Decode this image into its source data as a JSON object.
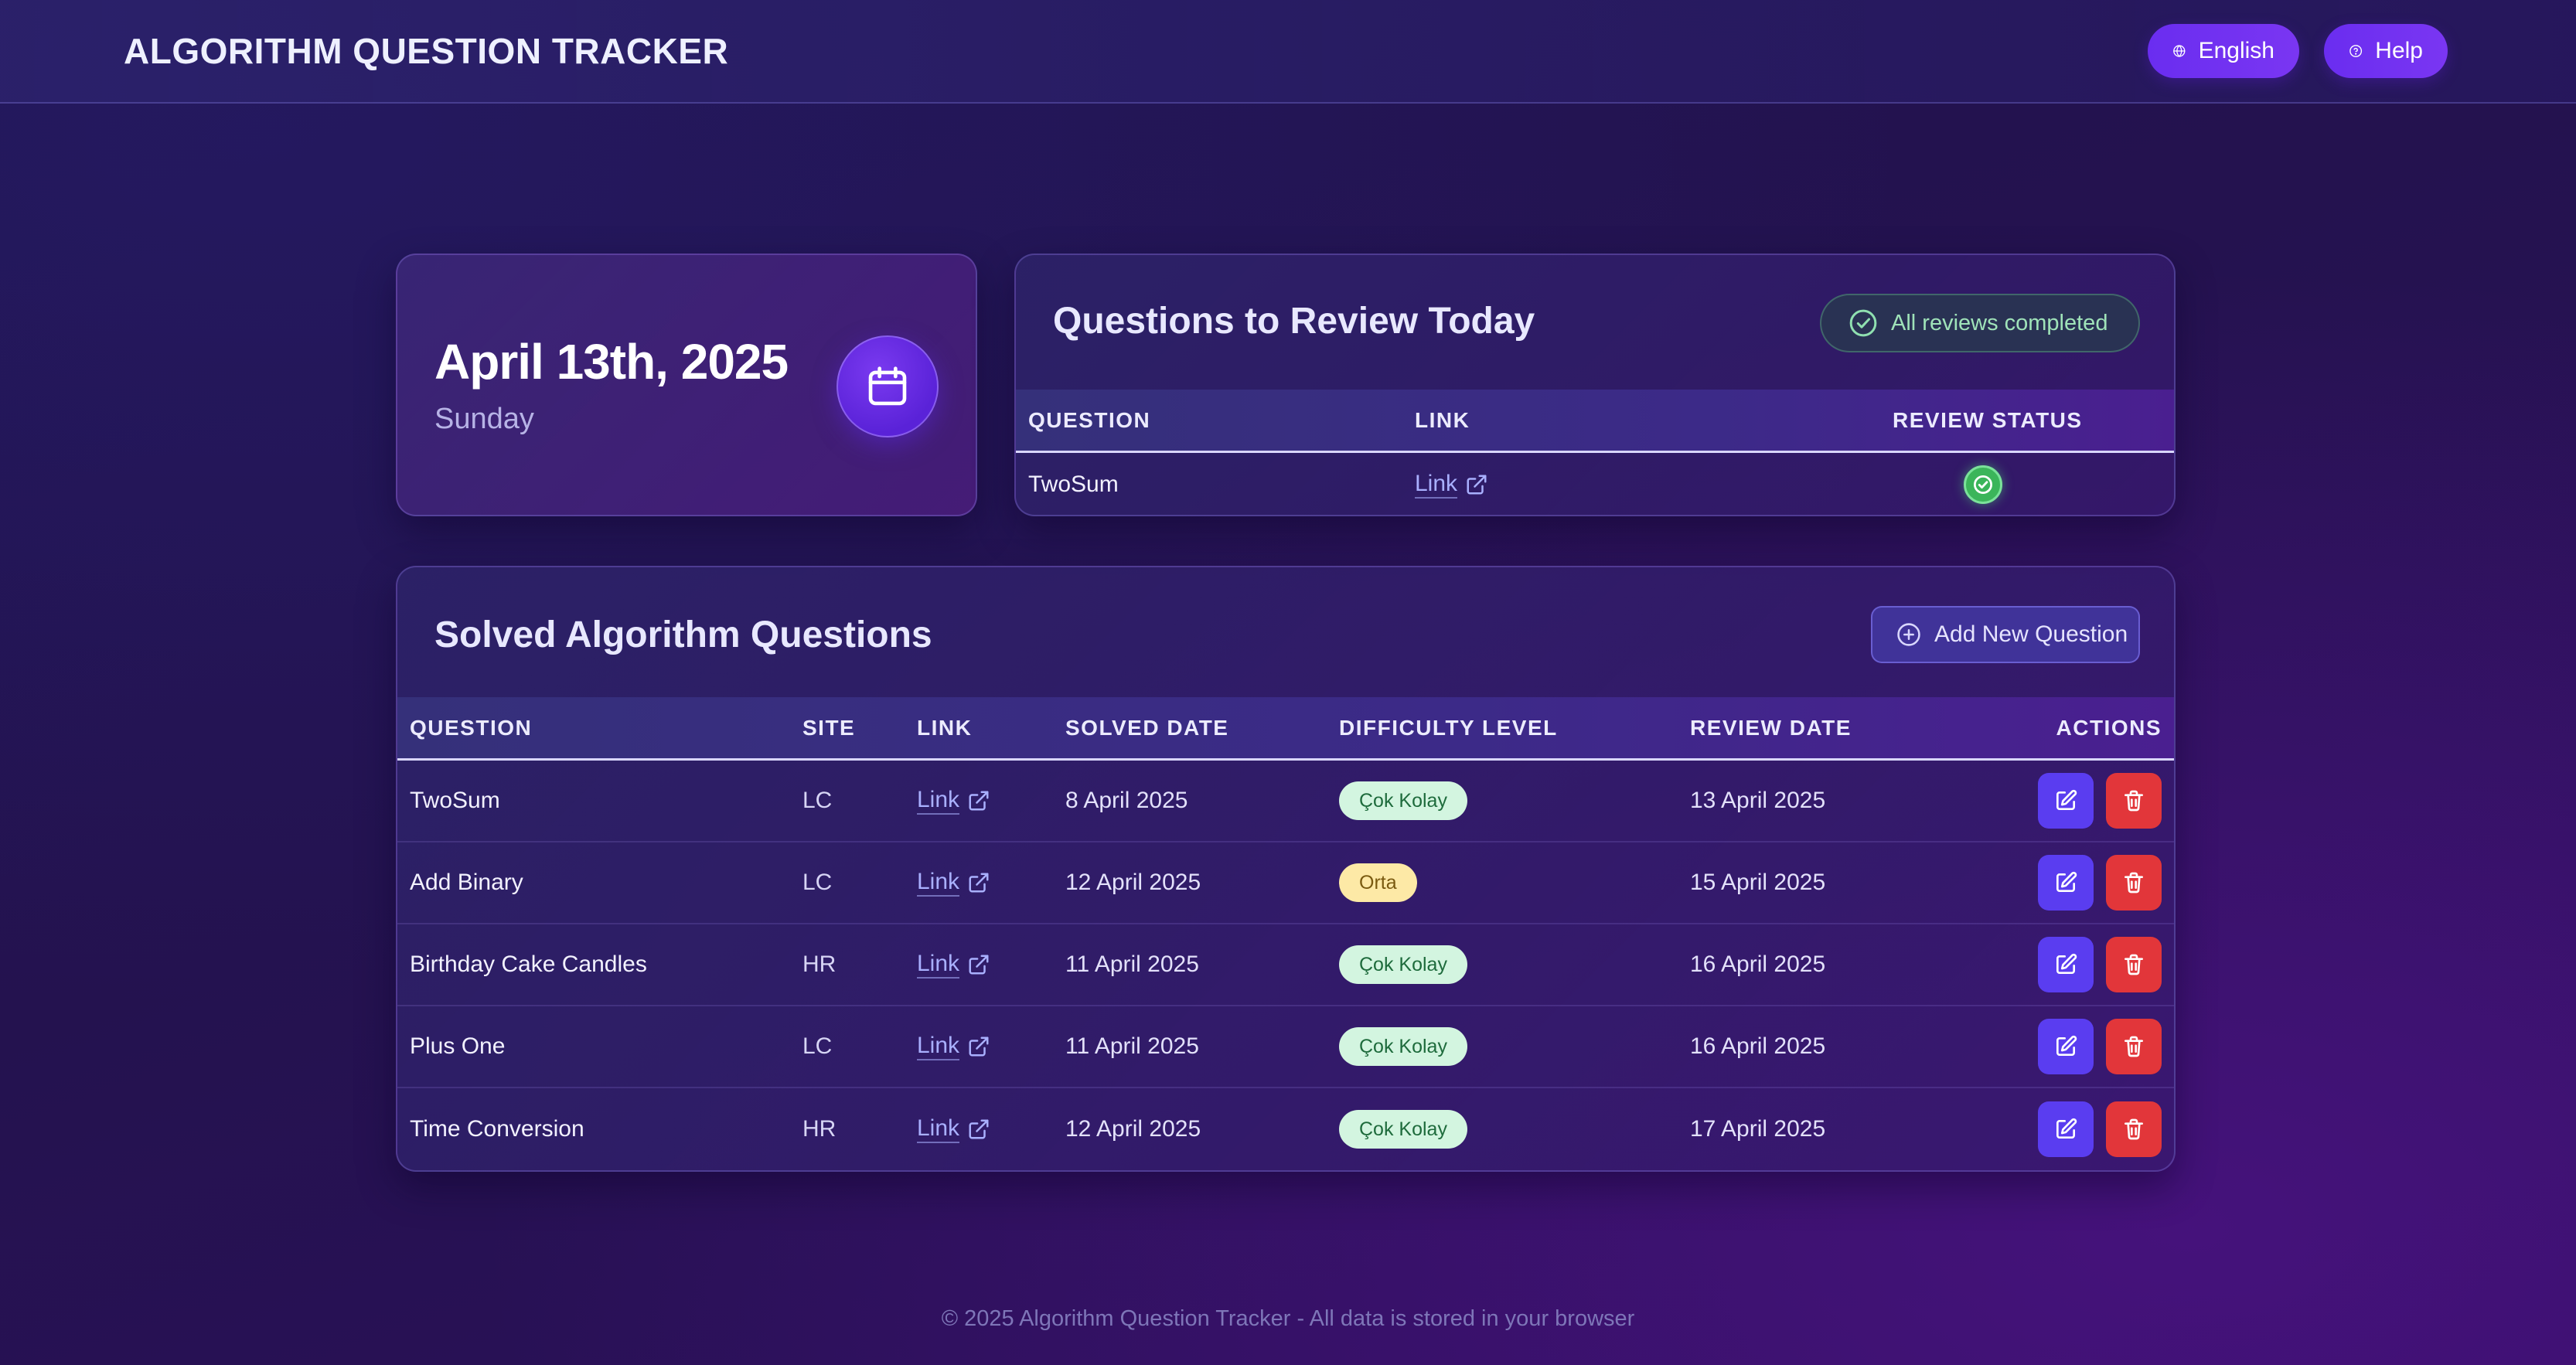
{
  "header": {
    "title": "ALGORITHM QUESTION TRACKER",
    "language_label": "English",
    "help_label": "Help"
  },
  "date_card": {
    "date": "April 13th, 2025",
    "weekday": "Sunday"
  },
  "review_today": {
    "title": "Questions to Review Today",
    "status_label": "All reviews completed",
    "columns": [
      "QUESTION",
      "LINK",
      "REVIEW STATUS"
    ],
    "rows": [
      {
        "question": "TwoSum",
        "link": "Link",
        "status": "completed"
      }
    ]
  },
  "solved": {
    "title": "Solved Algorithm Questions",
    "add_label": "Add New Question",
    "columns": [
      "QUESTION",
      "SITE",
      "LINK",
      "SOLVED DATE",
      "DIFFICULTY LEVEL",
      "REVIEW DATE",
      "ACTIONS"
    ],
    "rows": [
      {
        "question": "TwoSum",
        "site": "LC",
        "link": "Link",
        "solved_date": "8 April 2025",
        "difficulty": "Çok Kolay",
        "level": "easy",
        "review_date": "13 April 2025"
      },
      {
        "question": "Add Binary",
        "site": "LC",
        "link": "Link",
        "solved_date": "12 April 2025",
        "difficulty": "Orta",
        "level": "medium",
        "review_date": "15 April 2025"
      },
      {
        "question": "Birthday Cake Candles",
        "site": "HR",
        "link": "Link",
        "solved_date": "11 April 2025",
        "difficulty": "Çok Kolay",
        "level": "easy",
        "review_date": "16 April 2025"
      },
      {
        "question": "Plus One",
        "site": "LC",
        "link": "Link",
        "solved_date": "11 April 2025",
        "difficulty": "Çok Kolay",
        "level": "easy",
        "review_date": "16 April 2025"
      },
      {
        "question": "Time Conversion",
        "site": "HR",
        "link": "Link",
        "solved_date": "12 April 2025",
        "difficulty": "Çok Kolay",
        "level": "easy",
        "review_date": "17 April 2025"
      }
    ]
  },
  "icons": {
    "language": "globe-icon",
    "help": "help-circle-icon",
    "calendar": "calendar-icon",
    "status": "check-circle-icon",
    "add": "plus-circle-icon",
    "link": "external-link-icon",
    "edit": "edit-icon",
    "delete": "trash-icon"
  },
  "colors": {
    "accent": "#6a2df0",
    "edit": "#5a3df0",
    "delete": "#e2363a",
    "success": "#3bb55a",
    "easy_bg": "#d3f5e0",
    "medium_bg": "#fde9a6"
  },
  "footer": {
    "text": "© 2025 Algorithm Question Tracker - All data is stored in your browser"
  }
}
